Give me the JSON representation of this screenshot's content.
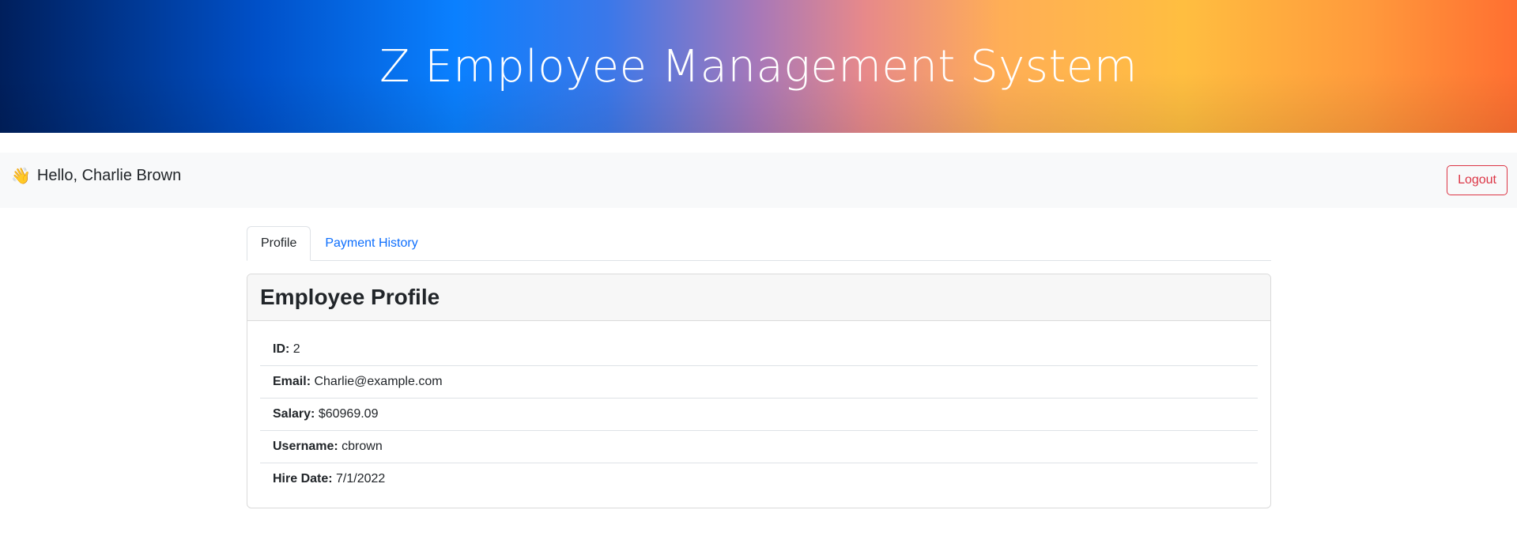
{
  "header": {
    "title": "Z Employee Management System"
  },
  "navbar": {
    "wave_emoji": "👋",
    "greeting": "Hello, Charlie Brown",
    "logout_label": "Logout"
  },
  "tabs": [
    {
      "label": "Profile",
      "active": true
    },
    {
      "label": "Payment History",
      "active": false
    }
  ],
  "profile": {
    "title": "Employee Profile",
    "fields": [
      {
        "label": "ID:",
        "value": "2"
      },
      {
        "label": "Email:",
        "value": "Charlie@example.com"
      },
      {
        "label": "Salary:",
        "value": "$60969.09"
      },
      {
        "label": "Username:",
        "value": "cbrown"
      },
      {
        "label": "Hire Date:",
        "value": "7/1/2022"
      }
    ]
  },
  "colors": {
    "danger": "#dc3545",
    "link": "#0d6efd",
    "navbar_bg": "#f8f9fa"
  }
}
